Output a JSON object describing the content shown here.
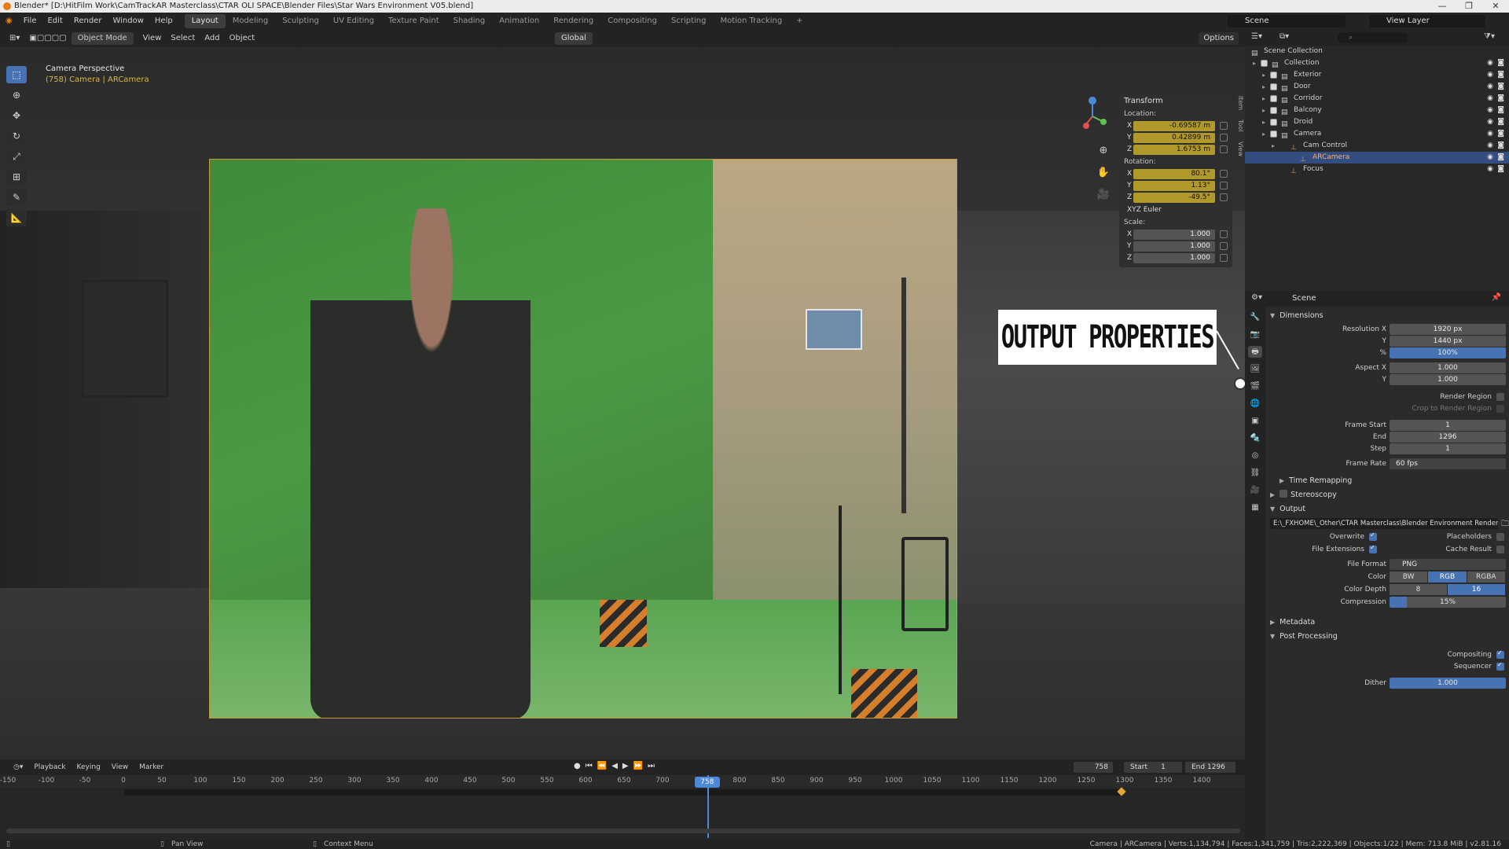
{
  "window": {
    "title": "Blender* [D:\\HitFilm Work\\CamTrackAR Masterclass\\CTAR OLI SPACE\\Blender Files\\Star Wars Environment V05.blend]"
  },
  "menu": [
    "File",
    "Edit",
    "Render",
    "Window",
    "Help"
  ],
  "workspaces": [
    "Layout",
    "Modeling",
    "Sculpting",
    "UV Editing",
    "Texture Paint",
    "Shading",
    "Animation",
    "Rendering",
    "Compositing",
    "Scripting",
    "Motion Tracking",
    "+"
  ],
  "active_workspace": "Layout",
  "scene_name": "Scene",
  "view_layer": "View Layer",
  "viewport": {
    "mode": "Object Mode",
    "menus": [
      "View",
      "Select",
      "Add",
      "Object"
    ],
    "orientation": "Global",
    "options": "Options",
    "camera_title": "Camera Perspective",
    "camera_sub": "(758) Camera | ARCamera"
  },
  "transform": {
    "header": "Transform",
    "location_label": "Location:",
    "location": {
      "x": "-0.69587 m",
      "y": "0.42899 m",
      "z": "1.6753 m"
    },
    "rotation_label": "Rotation:",
    "rotation": {
      "x": "80.1°",
      "y": "1.13°",
      "z": "-49.5°"
    },
    "rotation_mode": "XYZ Euler",
    "scale_label": "Scale:",
    "scale": {
      "x": "1.000",
      "y": "1.000",
      "z": "1.000"
    },
    "axis_x": "X",
    "axis_y": "Y",
    "axis_z": "Z",
    "tabs": [
      "Item",
      "Tool",
      "View"
    ]
  },
  "callout": "OUTPUT PROPERTIES",
  "outliner": {
    "root": "Scene Collection",
    "rows": [
      {
        "label": "Collection",
        "indent": 1
      },
      {
        "label": "Exterior",
        "indent": 2
      },
      {
        "label": "Door",
        "indent": 2
      },
      {
        "label": "Corridor",
        "indent": 2
      },
      {
        "label": "Balcony",
        "indent": 2
      },
      {
        "label": "Droid",
        "indent": 2
      },
      {
        "label": "Camera",
        "indent": 2
      },
      {
        "label": "Cam Control",
        "indent": 3
      },
      {
        "label": "ARCamera",
        "indent": 4
      },
      {
        "label": "Focus",
        "indent": 3
      }
    ],
    "selected": "ARCamera"
  },
  "properties": {
    "context": "Scene",
    "dimensions": "Dimensions",
    "res_x_label": "Resolution X",
    "res_x": "1920 px",
    "res_y_label": "Y",
    "res_y": "1440 px",
    "res_pct_label": "%",
    "res_pct": "100%",
    "aspect_x_label": "Aspect X",
    "aspect_x": "1.000",
    "aspect_y_label": "Y",
    "aspect_y": "1.000",
    "render_region": "Render Region",
    "crop_region": "Crop to Render Region",
    "frame_start_label": "Frame Start",
    "frame_start": "1",
    "end_label": "End",
    "end": "1296",
    "step_label": "Step",
    "step": "1",
    "frame_rate_label": "Frame Rate",
    "frame_rate": "60 fps",
    "time_remapping": "Time Remapping",
    "stereoscopy": "Stereoscopy",
    "output": "Output",
    "output_path": "E:\\_FXHOME\\_Other\\CTAR Masterclass\\Blender Environment Render ...",
    "overwrite": "Overwrite",
    "placeholders": "Placeholders",
    "file_extensions": "File Extensions",
    "cache_result": "Cache Result",
    "file_format_label": "File Format",
    "file_format": "PNG",
    "color_label": "Color",
    "color_opts": [
      "BW",
      "RGB",
      "RGBA"
    ],
    "color_depth_label": "Color Depth",
    "depth_opts": [
      "8",
      "16"
    ],
    "compression_label": "Compression",
    "compression": "15%",
    "compression_value": 15,
    "metadata": "Metadata",
    "post_processing": "Post Processing",
    "compositing": "Compositing",
    "sequencer": "Sequencer",
    "dither_label": "Dither",
    "dither": "1.000"
  },
  "timeline": {
    "menus": [
      "Playback",
      "Keying",
      "View",
      "Marker"
    ],
    "current_frame": "758",
    "start_label": "Start",
    "start": "1",
    "end_label": "End",
    "end": "1296",
    "ticks": [
      "-150",
      "-100",
      "-50",
      "0",
      "50",
      "100",
      "150",
      "200",
      "250",
      "300",
      "350",
      "400",
      "450",
      "500",
      "550",
      "600",
      "650",
      "700",
      "750",
      "800",
      "850",
      "900",
      "950",
      "1000",
      "1050",
      "1100",
      "1150",
      "1200",
      "1250",
      "1300",
      "1350",
      "1400"
    ],
    "playhead": "758"
  },
  "status": {
    "left1": "Pan View",
    "left2": "Context Menu",
    "right": "Camera | ARCamera | Verts:1,134,794 | Faces:1,341,759 | Tris:2,222,369 | Objects:1/22 | Mem: 713.8 MiB | v2.81.16"
  },
  "colors": {
    "accent": "#4772b3",
    "keyframe": "#b1982b",
    "playhead": "#4c89d8"
  }
}
